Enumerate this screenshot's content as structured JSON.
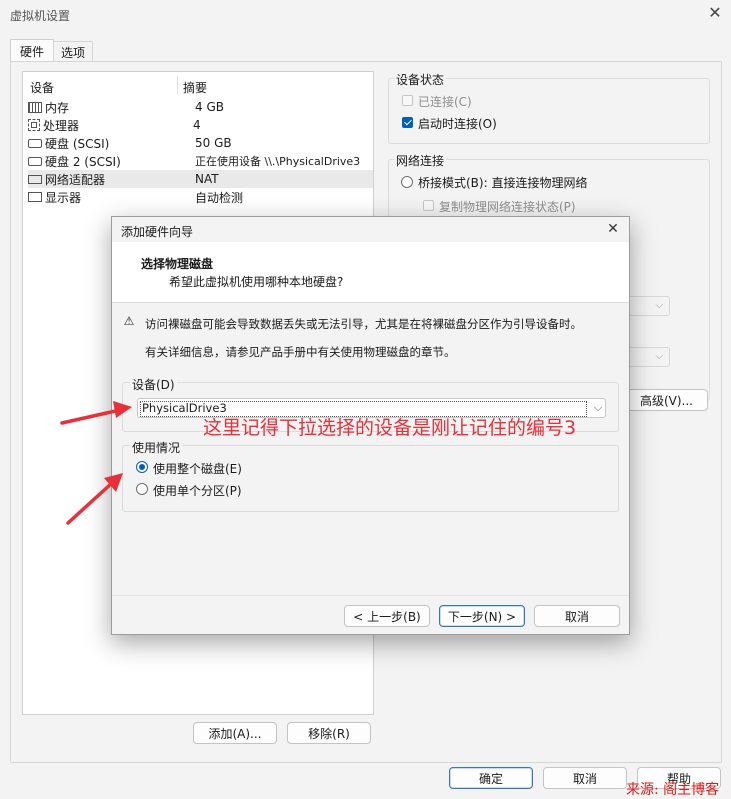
{
  "window": {
    "title": "虚拟机设置"
  },
  "tabs": [
    {
      "label": "硬件"
    },
    {
      "label": "选项"
    }
  ],
  "device_table": {
    "headers": {
      "device": "设备",
      "summary": "摘要"
    },
    "rows": [
      {
        "name": "内存",
        "summary": "4 GB",
        "icon": "memory-icon"
      },
      {
        "name": "处理器",
        "summary": "4",
        "icon": "cpu-icon"
      },
      {
        "name": "硬盘 (SCSI)",
        "summary": "50 GB",
        "icon": "disk-icon"
      },
      {
        "name": "硬盘 2 (SCSI)",
        "summary": "正在使用设备 \\\\.\\PhysicalDrive3",
        "icon": "disk-icon"
      },
      {
        "name": "网络适配器",
        "summary": "NAT",
        "icon": "network-icon"
      },
      {
        "name": "显示器",
        "summary": "自动检测",
        "icon": "monitor-icon"
      }
    ]
  },
  "left_buttons": {
    "add": "添加(A)...",
    "remove": "移除(R)"
  },
  "device_status": {
    "title": "设备状态",
    "connected": "已连接(C)",
    "connect_at_power_on": "启动时连接(O)"
  },
  "network": {
    "title": "网络连接",
    "bridged": "桥接模式(B): 直接连接物理网络",
    "replicate": "复制物理网络连接状态(P)"
  },
  "advanced_button": "高级(V)...",
  "bottom_buttons": {
    "ok": "确定",
    "cancel": "取消",
    "help": "帮助"
  },
  "wizard": {
    "title": "添加硬件向导",
    "heading": "选择物理磁盘",
    "subheading": "希望此虚拟机使用哪种本地硬盘?",
    "warning": "访问裸磁盘可能会导致数据丢失或无法引导，尤其是在将裸磁盘分区作为引导设备时。",
    "info": "有关详细信息，请参见产品手册中有关使用物理磁盘的章节。",
    "device_group": "设备(D)",
    "device_value": "PhysicalDrive3",
    "usage_group": "使用情况",
    "use_entire": "使用整个磁盘(E)",
    "use_partition": "使用单个分区(P)",
    "back": "< 上一步(B)",
    "next": "下一步(N) >",
    "cancel": "取消"
  },
  "annotation": "这里记得下拉选择的设备是刚让记住的编号3",
  "watermark": "来源: 阁主博客",
  "colors": {
    "accent": "#005fb8",
    "annotation_red": "#e8303a"
  }
}
